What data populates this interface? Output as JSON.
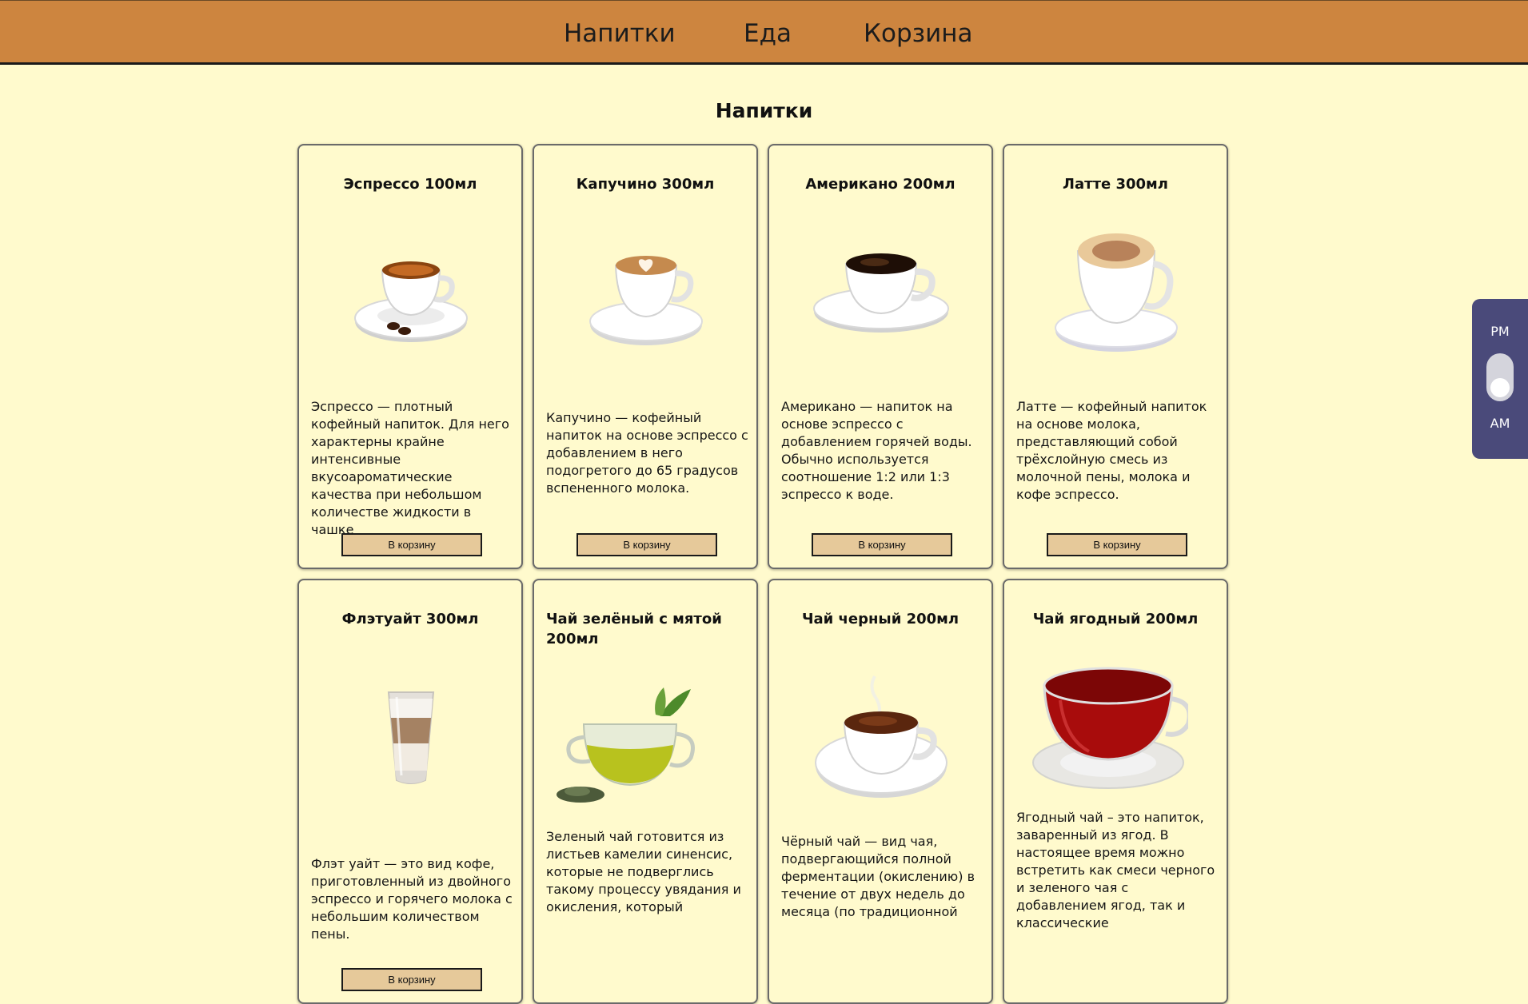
{
  "nav": {
    "drinks": "Напитки",
    "food": "Еда",
    "cart": "Корзина"
  },
  "page_title": "Напитки",
  "cart_button_label": "В корзину",
  "products": [
    {
      "title": "Эспрессо 100мл",
      "image": "espresso-cup-icon",
      "description": "Эспрессо — плотный кофейный напиток. Для него характерны крайне интенсивные вкусоароматические качества при небольшом количестве жидкости в чашке"
    },
    {
      "title": "Капучино 300мл",
      "image": "cappuccino-cup-icon",
      "description": "Капучино — кофейный напиток на основе эспрессо с добавлением в него подогретого до 65 градусов вспененного молока."
    },
    {
      "title": "Американо 200мл",
      "image": "americano-cup-icon",
      "description": "Американо — напиток на основе эспрессо с добавлением горячей воды. Обычно используется соотношение 1:2 или 1:3 эспрессо к воде."
    },
    {
      "title": "Латте 300мл",
      "image": "latte-cup-icon",
      "description": "Латте — кофейный напиток на основе молока, представляющий собой трёхслойную смесь из молочной пены, молока и кофе эспрессо."
    },
    {
      "title": "Флэтуайт 300мл",
      "image": "flat-white-glass-icon",
      "description": "Флэт уайт — это вид кофе, приготовленный из двойного эспрессо и горячего молока с небольшим количеством пены."
    },
    {
      "title": "Чай зелёный с мятой 200мл",
      "image": "green-tea-cup-icon",
      "description": "Зеленый чай готовится из листьев камелии синенсис, которые не подверглись такому процессу увядания и окисления, который"
    },
    {
      "title": "Чай черный 200мл",
      "image": "black-tea-cup-icon",
      "description": "Чёрный чай — вид чая, подвергающийся полной ферментации (окислению) в течение от двух недель до месяца (по традиционной"
    },
    {
      "title": "Чай ягодный 200мл",
      "image": "berry-tea-cup-icon",
      "description": "Ягодный чай – это напиток, заваренный из ягод. В настоящее время можно встретить как смеси черного и зеленого чая с добавлением ягод, так и классические"
    }
  ],
  "time_switch": {
    "pm": "PM",
    "am": "AM",
    "selected": "AM"
  },
  "colors": {
    "header": "#cd853f",
    "background": "#fffacd",
    "button": "#e6c99a",
    "switch_panel": "#4a4a7a"
  }
}
